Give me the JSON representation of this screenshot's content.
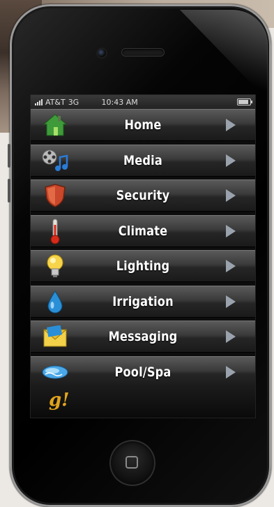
{
  "status_bar": {
    "carrier": "AT&T",
    "network": "3G",
    "time": "10:43 AM",
    "battery_level": 0.95
  },
  "menu": {
    "items": [
      {
        "label": "Home",
        "icon": "house-icon"
      },
      {
        "label": "Media",
        "icon": "film-music-icon"
      },
      {
        "label": "Security",
        "icon": "shield-icon"
      },
      {
        "label": "Climate",
        "icon": "thermometer-icon"
      },
      {
        "label": "Lighting",
        "icon": "lightbulb-icon"
      },
      {
        "label": "Irrigation",
        "icon": "water-drop-icon"
      },
      {
        "label": "Messaging",
        "icon": "envelope-icon"
      },
      {
        "label": "Pool/Spa",
        "icon": "pool-icon"
      }
    ]
  },
  "footer": {
    "logo": "g!"
  },
  "colors": {
    "logo": "#e0a41c",
    "chevron": "#9aa3ad"
  }
}
